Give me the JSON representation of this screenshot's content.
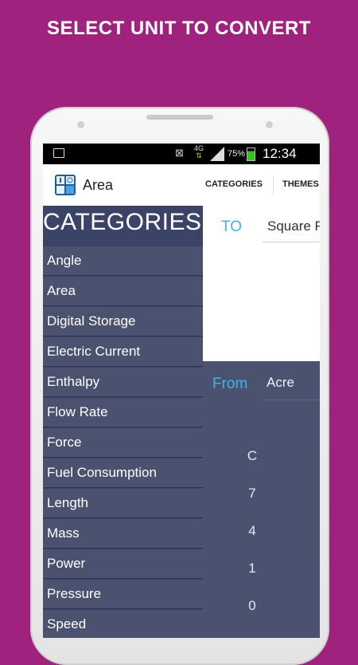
{
  "promo": {
    "headline": "SELECT UNIT TO CONVERT"
  },
  "status_bar": {
    "network": "4G",
    "battery": "75%",
    "time": "12:34 PM"
  },
  "app_bar": {
    "title": "Area",
    "tabs": [
      "CATEGORIES",
      "THEMES"
    ]
  },
  "drawer": {
    "title": "CATEGORIES",
    "items": [
      "Angle",
      "Area",
      "Digital Storage",
      "Electric Current",
      "Enthalpy",
      "Flow Rate",
      "Force",
      "Fuel Consumption",
      "Length",
      "Mass",
      "Power",
      "Pressure",
      "Speed"
    ]
  },
  "converter": {
    "to_label": "TO",
    "to_unit": "Square F",
    "from_label": "From",
    "from_unit": "Acre",
    "keypad": [
      "C",
      "7",
      "4",
      "1",
      "0"
    ]
  },
  "colors": {
    "background": "#a0227f",
    "drawer": "#3b4466",
    "accent": "#3db4e6"
  }
}
